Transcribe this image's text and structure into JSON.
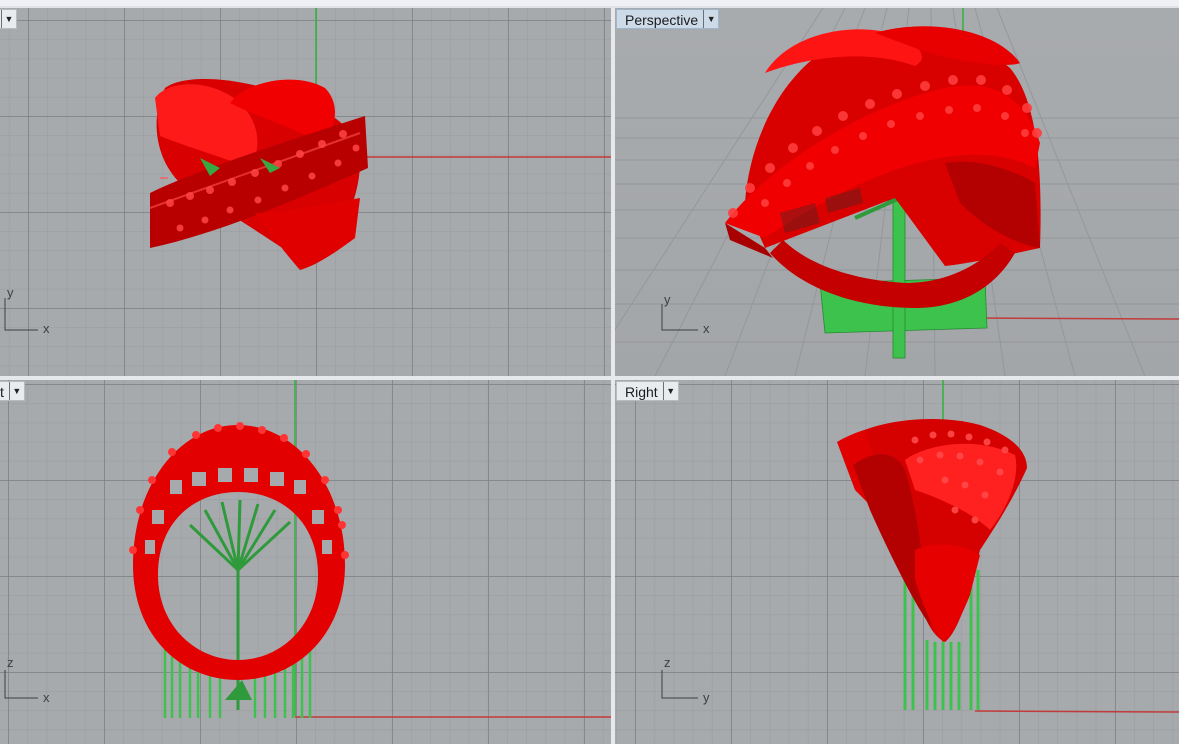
{
  "viewports": {
    "top": {
      "label": "",
      "axis_h": "x",
      "axis_v": "y"
    },
    "perspective": {
      "label": "Perspective",
      "axis_h": "x",
      "axis_v": "y"
    },
    "front": {
      "label": "t",
      "axis_h": "x",
      "axis_v": "z"
    },
    "right": {
      "label": "Right",
      "axis_h": "y",
      "axis_v": "z"
    }
  },
  "icons": {
    "viewport_menu": "chevron-down-icon"
  },
  "colors": {
    "model": "#e00000",
    "supports": "#3db34a",
    "axis_x": "#c23b3b",
    "axis_y": "#3db34a",
    "grid_bg": "#a7aaad",
    "active_label": "#cddbe9"
  }
}
